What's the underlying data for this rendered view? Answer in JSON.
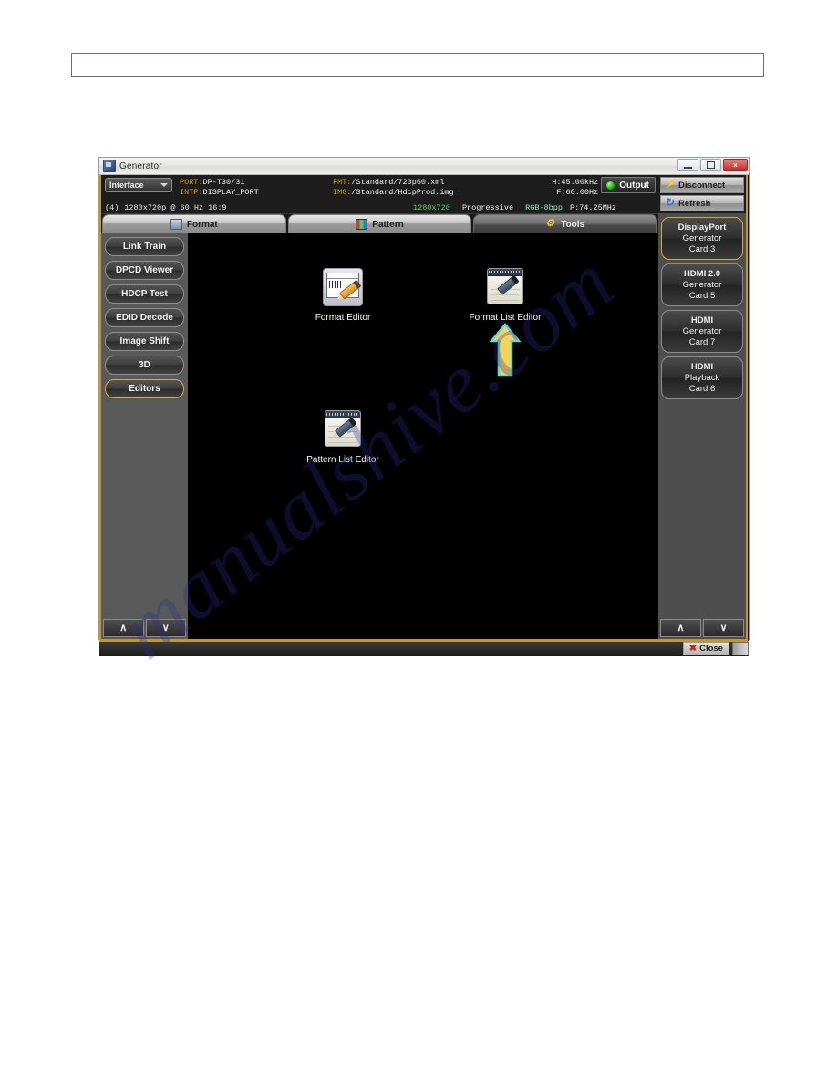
{
  "watermark": {
    "text": "manualshive.com"
  },
  "window": {
    "title": "Generator",
    "icon": "monitor-icon",
    "buttons": {
      "minimize": "minimize-button",
      "maximize": "maximize-button",
      "close": "×"
    }
  },
  "info": {
    "interface_label": "Interface",
    "port_key": "PORT:",
    "port_value": "DP-T30/31",
    "intp_key": "INTP:",
    "intp_value": "DISPLAY_PORT",
    "fmt_key": "FMT:",
    "fmt_value": "/Standard/720p60.xml",
    "img_key": "IMG:",
    "img_value": "/Standard/HdcpProd.img",
    "h_freq": "H:45.00kHz",
    "f_freq": "F:60.00Hz",
    "p_freq": "P:74.25MHz",
    "output_label": "Output",
    "mode_index": "(4)",
    "mode_text": "1280x720p @ 60 Hz 16:9",
    "timing_res": "1280x720",
    "timing_scan": "Progressive",
    "timing_color": "RGB-8bpp"
  },
  "tabs": [
    {
      "label": "Format",
      "icon": "monitor-icon",
      "active": false
    },
    {
      "label": "Pattern",
      "icon": "color-bars-icon",
      "active": false
    },
    {
      "label": "Tools",
      "icon": "tools-icon",
      "active": true
    }
  ],
  "left_nav": {
    "items": [
      {
        "label": "Link Train",
        "selected": false
      },
      {
        "label": "DPCD Viewer",
        "selected": false
      },
      {
        "label": "HDCP Test",
        "selected": false
      },
      {
        "label": "EDID Decode",
        "selected": false
      },
      {
        "label": "Image Shift",
        "selected": false
      },
      {
        "label": "3D",
        "selected": false
      },
      {
        "label": "Editors",
        "selected": true
      }
    ],
    "scroll_up": "∧",
    "scroll_down": "∨"
  },
  "canvas": {
    "icons": [
      {
        "label": "Format Editor",
        "glyph": "ruler-pencil-icon"
      },
      {
        "label": "Format List Editor",
        "glyph": "notepad-pencil-icon"
      },
      {
        "label": "Pattern List Editor",
        "glyph": "notepad-pencil-icon"
      }
    ],
    "annotation": {
      "name": "up-arrow-annotation",
      "fill": "#f2d45c",
      "stroke": "#5fd8d8"
    }
  },
  "right_nav": {
    "top_buttons": [
      {
        "label": "Disconnect",
        "icon": "plug-icon"
      },
      {
        "label": "Refresh",
        "icon": "refresh-icon"
      }
    ],
    "cards": [
      {
        "line1": "DisplayPort",
        "line2": "Generator",
        "line3": "Card 3",
        "selected": true
      },
      {
        "line1": "HDMI 2.0",
        "line2": "Generator",
        "line3": "Card 5",
        "selected": false
      },
      {
        "line1": "HDMI",
        "line2": "Generator",
        "line3": "Card 7",
        "selected": false
      },
      {
        "line1": "HDMI",
        "line2": "Playback",
        "line3": "Card 6",
        "selected": false
      }
    ],
    "scroll_up": "∧",
    "scroll_down": "∨"
  },
  "footer": {
    "close_label": "Close",
    "close_mark": "✖"
  },
  "colors": {
    "accent_gold": "#c4972d",
    "selected_outline": "#d6aa3e",
    "canvas_bg": "#000000",
    "led_green": "#26b514",
    "watermark_blue": "#2b2f94"
  }
}
